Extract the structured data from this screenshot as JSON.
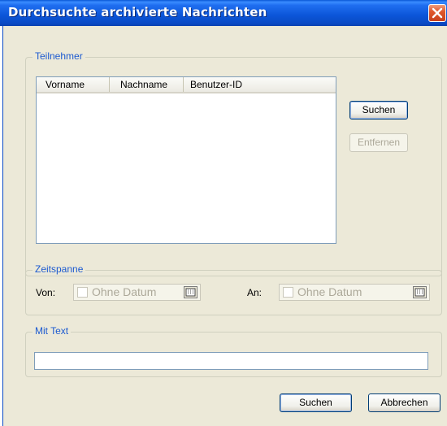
{
  "window": {
    "title": "Durchsuchte archivierte Nachrichten"
  },
  "participants": {
    "legend": "Teilnehmer",
    "columns": [
      "Vorname",
      "Nachname",
      "Benutzer-ID"
    ],
    "search_label": "Suchen",
    "remove_label": "Entfernen"
  },
  "timespan": {
    "legend": "Zeitspanne",
    "from_label": "Von:",
    "from_value": "Ohne Datum",
    "to_label": "An:",
    "to_value": "Ohne Datum"
  },
  "text_filter": {
    "legend": "Mit Text",
    "value": ""
  },
  "footer": {
    "search_label": "Suchen",
    "cancel_label": "Abbrechen"
  },
  "colors": {
    "title_bar": "#0a55d8",
    "dialog_bg": "#ece9d8",
    "legend_text": "#1c5ad0"
  }
}
